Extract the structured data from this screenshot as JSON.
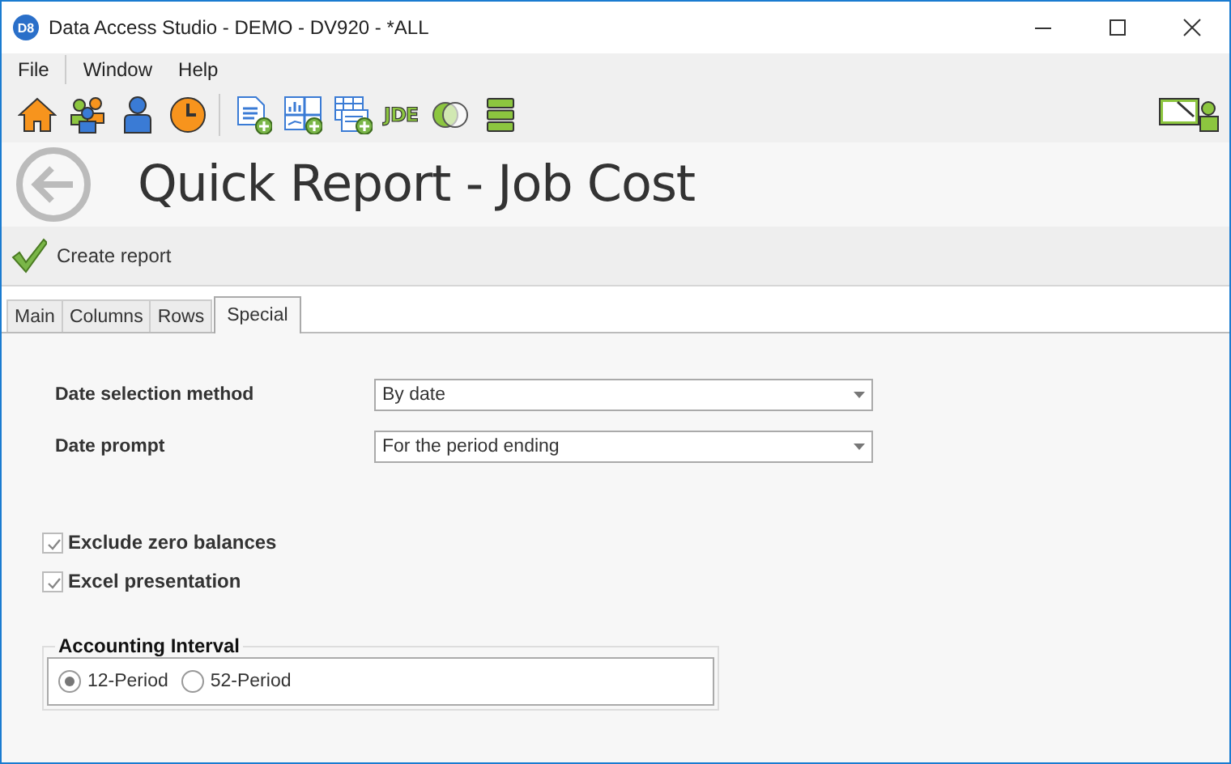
{
  "window": {
    "title": "Data Access Studio - DEMO - DV920 - *ALL",
    "logo": "D8"
  },
  "menu": [
    {
      "label": "File"
    },
    {
      "label": "Window"
    },
    {
      "label": "Help"
    }
  ],
  "toolbar": {
    "jde_label": "JDE"
  },
  "page": {
    "title": "Quick Report - Job Cost"
  },
  "actions": [
    {
      "label": "Create report"
    }
  ],
  "tabs": [
    {
      "label": "Main",
      "selected": false
    },
    {
      "label": "Columns",
      "selected": false
    },
    {
      "label": "Rows",
      "selected": false
    },
    {
      "label": "Special",
      "selected": true
    }
  ],
  "fields": [
    {
      "label": "Date selection method",
      "value": "By date"
    },
    {
      "label": "Date prompt",
      "value": "For the period ending"
    }
  ],
  "options": [
    {
      "label": "Exclude zero balances",
      "checked": true
    },
    {
      "label": "Excel presentation",
      "checked": true
    }
  ],
  "accounting_interval": {
    "title": "Accounting Interval",
    "choices": [
      {
        "label": "12-Period",
        "selected": true
      },
      {
        "label": "52-Period",
        "selected": false
      }
    ]
  }
}
